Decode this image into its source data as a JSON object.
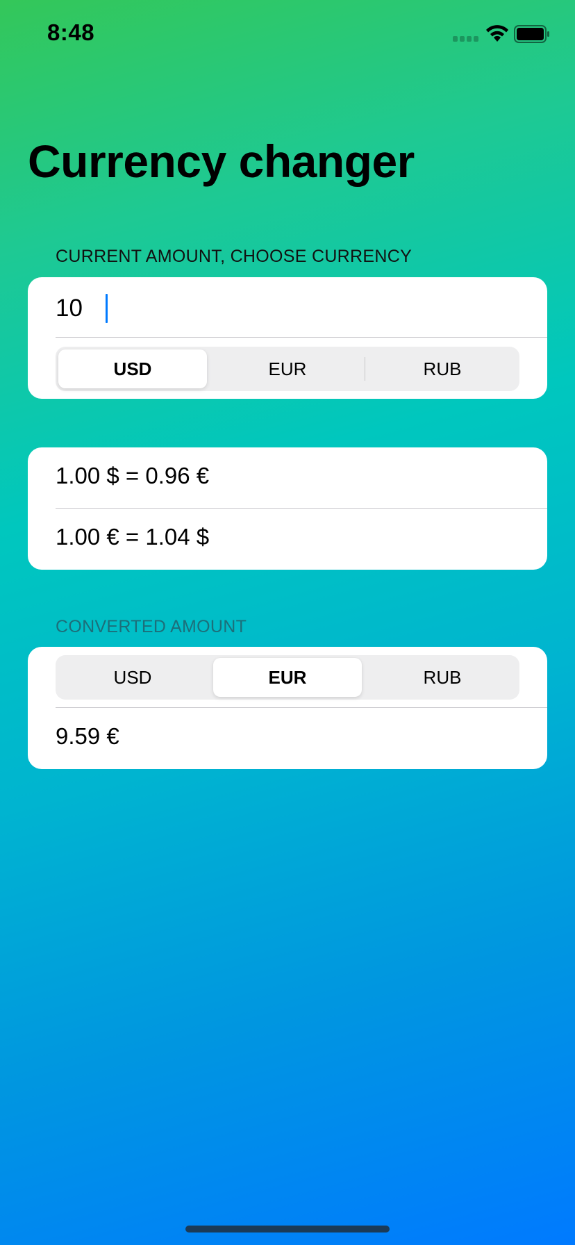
{
  "status_bar": {
    "time": "8:48",
    "icons": [
      "signal-icon",
      "wifi-icon",
      "battery-icon"
    ]
  },
  "title": "Currency changer",
  "input_section": {
    "header": "CURRENT AMOUNT, CHOOSE CURRENCY",
    "amount_value": "10",
    "currencies": [
      "USD",
      "EUR",
      "RUB"
    ],
    "selected": "USD"
  },
  "rates": {
    "usd_to_eur": "1.00 $ = 0.96 €",
    "eur_to_usd": "1.00 € = 1.04 $"
  },
  "converted_section": {
    "header": "CONVERTED AMOUNT",
    "currencies": [
      "USD",
      "EUR",
      "RUB"
    ],
    "selected": "EUR",
    "result": "9.59 €"
  },
  "colors": {
    "gradient_top": "#34C759",
    "gradient_mid": "#00C7BE",
    "gradient_bottom": "#007AFF",
    "caret": "#007AFF",
    "card": "#FFFFFF"
  }
}
